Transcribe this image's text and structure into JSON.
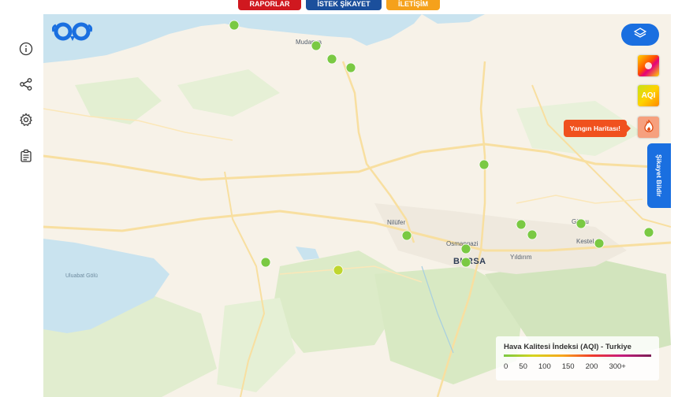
{
  "top_buttons": [
    {
      "label": "RAPORLAR",
      "color": "#d0181f"
    },
    {
      "label": "İSTEK ŞİKAYET",
      "color": "#1b4f9c"
    },
    {
      "label": "İLETİŞİM",
      "color": "#f5a11b"
    }
  ],
  "sidebar": {
    "icons": [
      "info-icon",
      "share-icon",
      "settings-icon",
      "report-icon"
    ]
  },
  "map": {
    "labels": {
      "mudanya": "Mudanya",
      "nilufer": "Nilüfer",
      "osmangazi": "Osmangazi",
      "bursa": "BURSA",
      "yildirim": "Yıldırım",
      "gursu": "Gürsu",
      "kestel": "Kestel",
      "ulubat": "Uluabat Gölü"
    },
    "stations": [
      {
        "name": "station-1",
        "color": "#7ac943"
      },
      {
        "name": "station-2",
        "color": "#7ac943"
      },
      {
        "name": "station-3",
        "color": "#7ac943"
      },
      {
        "name": "station-4",
        "color": "#7ac943"
      },
      {
        "name": "station-5",
        "color": "#7ac943"
      },
      {
        "name": "station-6",
        "color": "#7ac943"
      },
      {
        "name": "station-7",
        "color": "#7ac943"
      },
      {
        "name": "station-8",
        "color": "#7ac943"
      },
      {
        "name": "station-9",
        "color": "#7ac943"
      },
      {
        "name": "station-10",
        "color": "#7ac943"
      },
      {
        "name": "station-11",
        "color": "#7ac943"
      },
      {
        "name": "station-12",
        "color": "#7ac943"
      },
      {
        "name": "station-13",
        "color": "#7ac943"
      },
      {
        "name": "station-14",
        "color": "#bfd630"
      },
      {
        "name": "station-15",
        "color": "#7ac943"
      }
    ]
  },
  "controls": {
    "layers_icon": "layers-icon",
    "tiles": [
      {
        "label": "",
        "icon": "heatmap-icon"
      },
      {
        "label": "AQI",
        "icon": "aqi-icon"
      },
      {
        "label": "",
        "icon": "fire-icon"
      }
    ],
    "fire_tooltip": "Yangın Haritası!",
    "complaint_tab": "Şikayet Bildir"
  },
  "legend": {
    "title": "Hava Kalitesi İndeksi (AQI) - Turkiye",
    "ticks": [
      "0",
      "50",
      "100",
      "150",
      "200",
      "300+"
    ]
  }
}
